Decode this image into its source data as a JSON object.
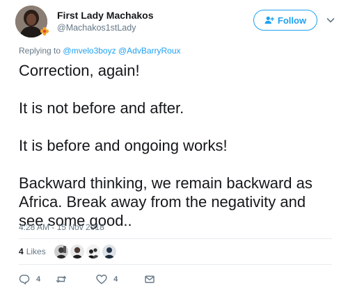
{
  "author": {
    "display_name": "First Lady Machakos",
    "screen_name": "@Machakos1stLady"
  },
  "follow": {
    "label": "Follow"
  },
  "reply_context": {
    "prefix": "Replying to",
    "mentions": [
      "@mvelo3boyz",
      "@AdvBarryRoux"
    ]
  },
  "tweet": {
    "paragraphs": [
      "Correction, again!",
      "It is not before and after.",
      "It is before and ongoing works!",
      "Backward thinking, we remain backward as Africa. Break away from the negativity and see some good.."
    ],
    "timestamp": "4:28 AM - 15 Nov 2018"
  },
  "likes": {
    "count": "4",
    "label": "Likes"
  },
  "actions": {
    "reply_count": "4",
    "like_count": "4"
  },
  "colors": {
    "brand_blue": "#1da1f2",
    "secondary_text": "#657786",
    "primary_text": "#14171a",
    "divider": "#e6ecf0"
  },
  "icons": {
    "follow": "add-user-icon",
    "caret": "chevron-down-icon",
    "reply": "reply-icon",
    "retweet": "retweet-icon",
    "like": "heart-icon",
    "message": "envelope-icon"
  }
}
